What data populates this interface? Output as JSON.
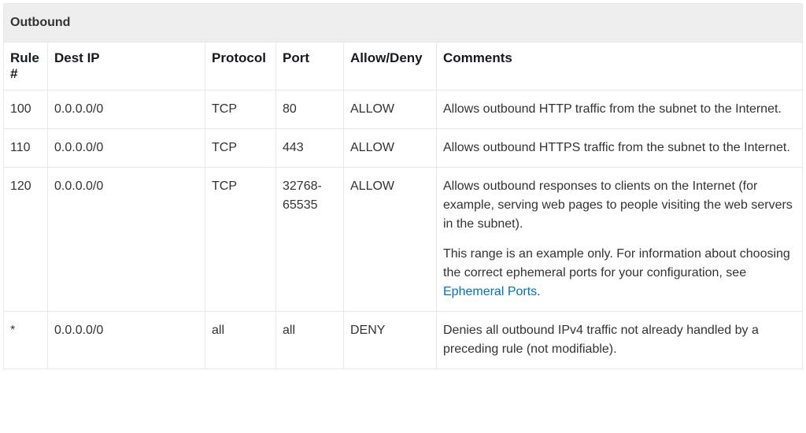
{
  "section_title": "Outbound",
  "headers": {
    "rule": "Rule #",
    "dest": "Dest IP",
    "proto": "Protocol",
    "port": "Port",
    "allow": "Allow/Deny",
    "comments": "Comments"
  },
  "rows": [
    {
      "rule": "100",
      "dest": "0.0.0.0/0",
      "proto": "TCP",
      "port": "80",
      "allow": "ALLOW",
      "comments": [
        {
          "text": "Allows outbound HTTP traffic from the subnet to the Internet."
        }
      ]
    },
    {
      "rule": "110",
      "dest": "0.0.0.0/0",
      "proto": "TCP",
      "port": "443",
      "allow": "ALLOW",
      "comments": [
        {
          "text": "Allows outbound HTTPS traffic from the subnet to the Internet."
        }
      ]
    },
    {
      "rule": "120",
      "dest": "0.0.0.0/0",
      "proto": "TCP",
      "port": "32768-65535",
      "allow": "ALLOW",
      "comments": [
        {
          "text": "Allows outbound responses to clients on the Internet (for example, serving web pages to people visiting the web servers in the subnet)."
        },
        {
          "text": "This range is an example only. For information about choosing the correct ephemeral ports for your configuration, see ",
          "link_text": "Ephemeral Ports",
          "after_link": "."
        }
      ]
    },
    {
      "rule": "*",
      "dest": "0.0.0.0/0",
      "proto": "all",
      "port": "all",
      "allow": "DENY",
      "comments": [
        {
          "text": "Denies all outbound IPv4 traffic not already handled by a preceding rule (not modifiable)."
        }
      ]
    }
  ]
}
